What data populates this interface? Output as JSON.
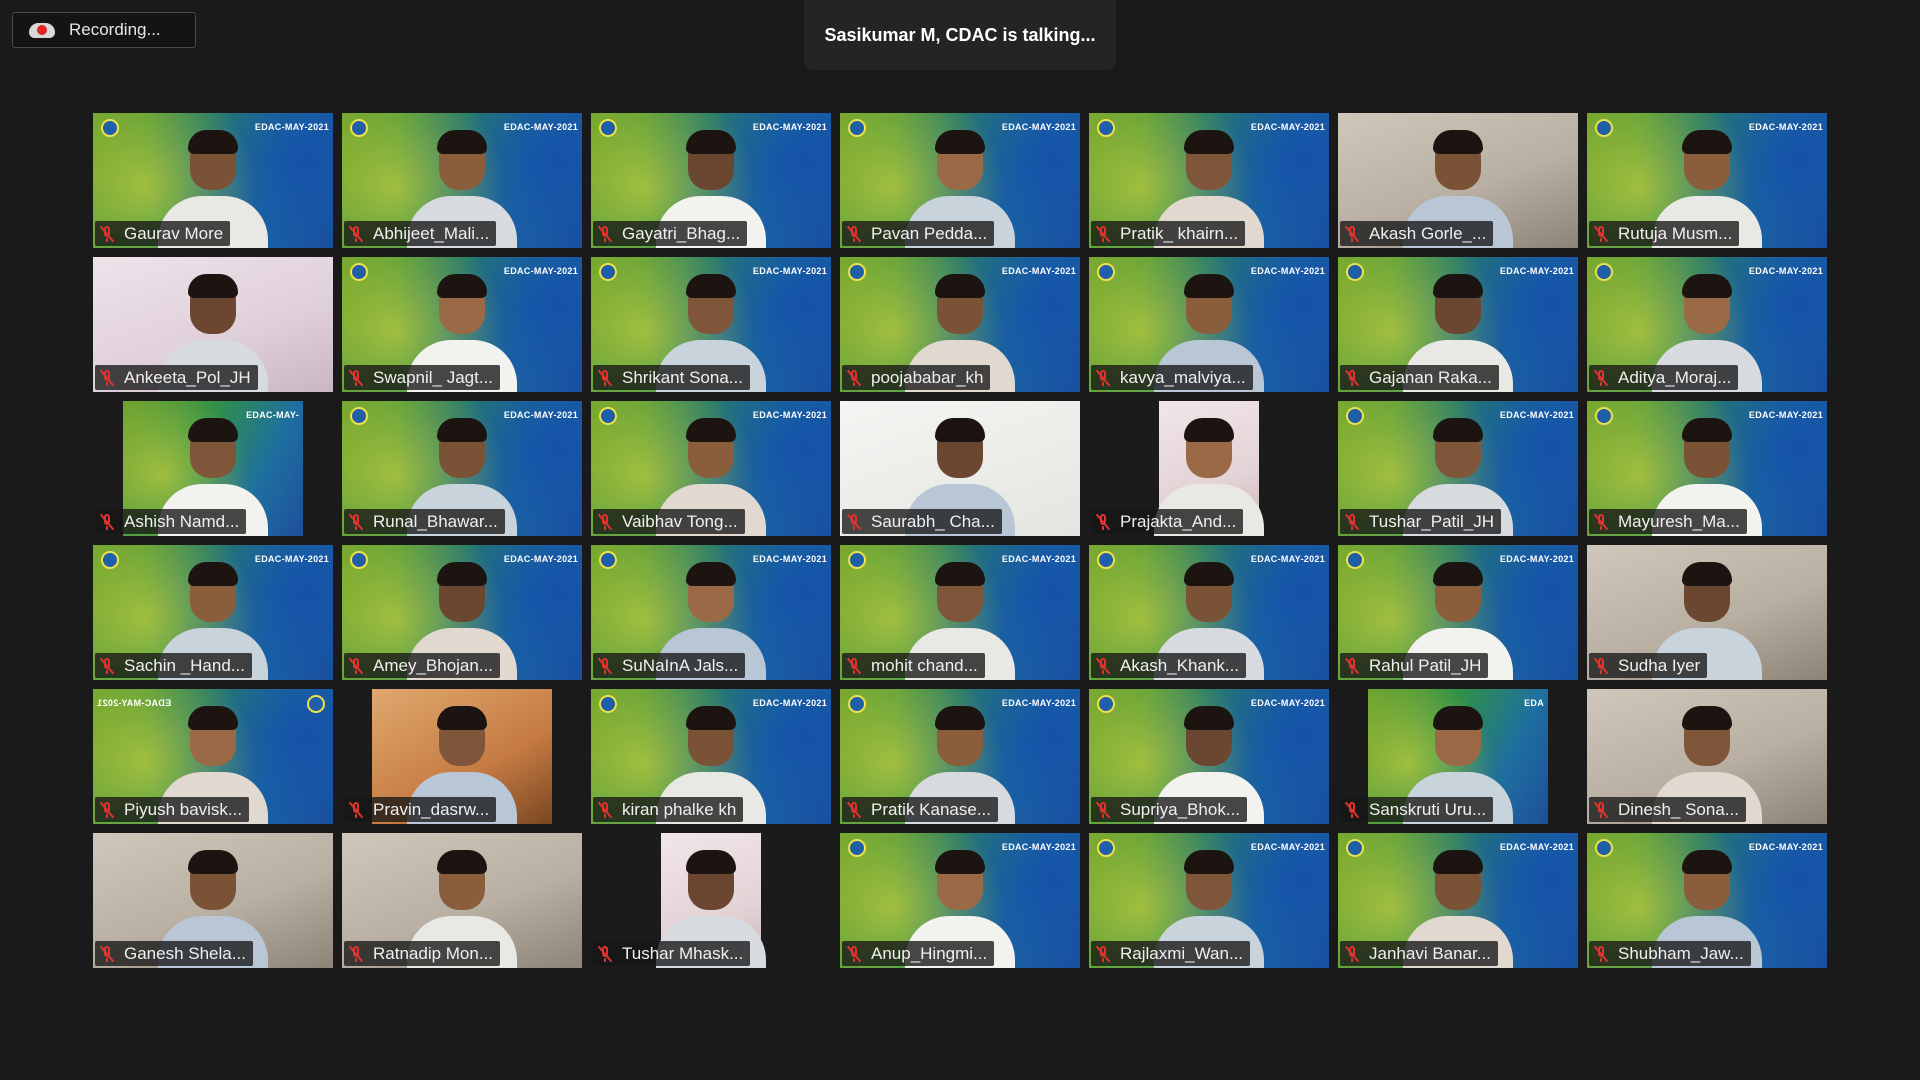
{
  "recording": {
    "label": "Recording..."
  },
  "speaker": {
    "label": "Sasikumar M, CDAC is talking..."
  },
  "brand_text": "EDAC-MAY-2021",
  "brand_text_short": "EDAC-MAY-",
  "brand_text_tiny": "EDA",
  "participants": [
    {
      "name": "Gaurav More",
      "bg": "vbg",
      "muted": true
    },
    {
      "name": "Abhijeet_Mali...",
      "bg": "vbg",
      "muted": true
    },
    {
      "name": "Gayatri_Bhag...",
      "bg": "vbg",
      "muted": true
    },
    {
      "name": "Pavan Pedda...",
      "bg": "vbg",
      "muted": true
    },
    {
      "name": "Pratik_ khairn...",
      "bg": "vbg",
      "muted": true
    },
    {
      "name": "Akash Gorle_...",
      "bg": "room",
      "muted": true
    },
    {
      "name": "Rutuja Musm...",
      "bg": "vbg",
      "muted": true
    },
    {
      "name": "Ankeeta_Pol_JH",
      "bg": "pink",
      "muted": true
    },
    {
      "name": "Swapnil_ Jagt...",
      "bg": "vbg",
      "muted": true
    },
    {
      "name": "Shrikant Sona...",
      "bg": "vbg",
      "muted": true
    },
    {
      "name": "poojababar_kh",
      "bg": "vbg",
      "muted": true
    },
    {
      "name": "kavya_malviya...",
      "bg": "vbg",
      "muted": true
    },
    {
      "name": "Gajanan Raka...",
      "bg": "vbg",
      "muted": true
    },
    {
      "name": "Aditya_Moraj...",
      "bg": "vbg",
      "muted": true
    },
    {
      "name": "Ashish Namd...",
      "bg": "narrow-vbg",
      "muted": true
    },
    {
      "name": "Runal_Bhawar...",
      "bg": "vbg",
      "muted": true
    },
    {
      "name": "Vaibhav Tong...",
      "bg": "vbg",
      "muted": true
    },
    {
      "name": "Saurabh_ Cha...",
      "bg": "light",
      "muted": true
    },
    {
      "name": "Prajakta_And...",
      "bg": "narrow-light",
      "muted": true
    },
    {
      "name": "Tushar_Patil_JH",
      "bg": "vbg",
      "muted": true
    },
    {
      "name": "Mayuresh_Ma...",
      "bg": "vbg",
      "muted": true
    },
    {
      "name": "Sachin _Hand...",
      "bg": "vbg",
      "muted": true
    },
    {
      "name": "Amey_Bhojan...",
      "bg": "vbg",
      "muted": true
    },
    {
      "name": "SuNaInA Jals...",
      "bg": "vbg",
      "muted": true
    },
    {
      "name": "mohit chand...",
      "bg": "vbg",
      "muted": true
    },
    {
      "name": "Akash_Khank...",
      "bg": "vbg",
      "muted": true
    },
    {
      "name": "Rahul Patil_JH",
      "bg": "vbg",
      "muted": true
    },
    {
      "name": "Sudha Iyer",
      "bg": "room",
      "muted": true
    },
    {
      "name": "Piyush bavisk...",
      "bg": "vbg-flip",
      "muted": true
    },
    {
      "name": "Pravin_dasrw...",
      "bg": "narrow-warm",
      "muted": true
    },
    {
      "name": "kiran phalke kh",
      "bg": "vbg",
      "muted": true
    },
    {
      "name": "Pratik Kanase...",
      "bg": "vbg",
      "muted": true
    },
    {
      "name": "Supriya_Bhok...",
      "bg": "vbg",
      "muted": true
    },
    {
      "name": "Sanskruti Uru...",
      "bg": "narrow-vbg-tiny",
      "muted": true
    },
    {
      "name": "Dinesh_ Sona...",
      "bg": "room",
      "muted": true
    },
    {
      "name": "Ganesh Shela...",
      "bg": "room",
      "muted": true
    },
    {
      "name": "Ratnadip Mon...",
      "bg": "room",
      "muted": true
    },
    {
      "name": "Tushar Mhask...",
      "bg": "narrow-light",
      "muted": true
    },
    {
      "name": "Anup_Hingmi...",
      "bg": "vbg",
      "muted": true
    },
    {
      "name": "Rajlaxmi_Wan...",
      "bg": "vbg",
      "muted": true
    },
    {
      "name": "Janhavi Banar...",
      "bg": "vbg",
      "muted": true
    },
    {
      "name": "Shubham_Jaw...",
      "bg": "vbg",
      "muted": true
    }
  ],
  "icons": {
    "muted": "mic-off-icon",
    "recording": "cloud-record-icon"
  },
  "colors": {
    "background": "#1a1a1a",
    "muted_red": "#e0332f",
    "recording_red": "#e02424"
  }
}
